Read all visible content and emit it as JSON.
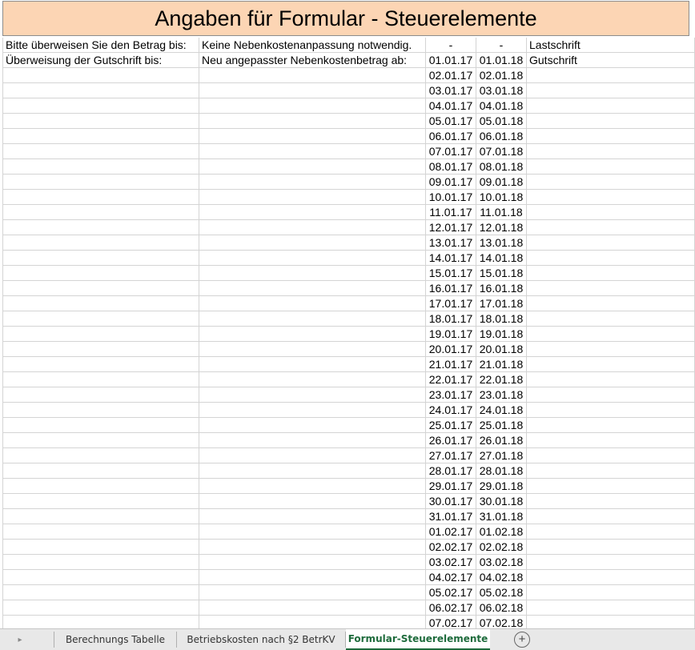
{
  "sheet": {
    "title": "Angaben für Formular - Steuerelemente",
    "rows": [
      [
        "Bitte überweisen Sie den Betrag bis:",
        "Keine Nebenkostenanpassung notwendig.",
        "-",
        "-",
        "Lastschrift"
      ],
      [
        "Überweisung der Gutschrift bis:",
        "Neu angepasster Nebenkostenbetrag ab:",
        "01.01.17",
        "01.01.18",
        "Gutschrift"
      ],
      [
        "",
        "",
        "02.01.17",
        "02.01.18",
        ""
      ],
      [
        "",
        "",
        "03.01.17",
        "03.01.18",
        ""
      ],
      [
        "",
        "",
        "04.01.17",
        "04.01.18",
        ""
      ],
      [
        "",
        "",
        "05.01.17",
        "05.01.18",
        ""
      ],
      [
        "",
        "",
        "06.01.17",
        "06.01.18",
        ""
      ],
      [
        "",
        "",
        "07.01.17",
        "07.01.18",
        ""
      ],
      [
        "",
        "",
        "08.01.17",
        "08.01.18",
        ""
      ],
      [
        "",
        "",
        "09.01.17",
        "09.01.18",
        ""
      ],
      [
        "",
        "",
        "10.01.17",
        "10.01.18",
        ""
      ],
      [
        "",
        "",
        "11.01.17",
        "11.01.18",
        ""
      ],
      [
        "",
        "",
        "12.01.17",
        "12.01.18",
        ""
      ],
      [
        "",
        "",
        "13.01.17",
        "13.01.18",
        ""
      ],
      [
        "",
        "",
        "14.01.17",
        "14.01.18",
        ""
      ],
      [
        "",
        "",
        "15.01.17",
        "15.01.18",
        ""
      ],
      [
        "",
        "",
        "16.01.17",
        "16.01.18",
        ""
      ],
      [
        "",
        "",
        "17.01.17",
        "17.01.18",
        ""
      ],
      [
        "",
        "",
        "18.01.17",
        "18.01.18",
        ""
      ],
      [
        "",
        "",
        "19.01.17",
        "19.01.18",
        ""
      ],
      [
        "",
        "",
        "20.01.17",
        "20.01.18",
        ""
      ],
      [
        "",
        "",
        "21.01.17",
        "21.01.18",
        ""
      ],
      [
        "",
        "",
        "22.01.17",
        "22.01.18",
        ""
      ],
      [
        "",
        "",
        "23.01.17",
        "23.01.18",
        ""
      ],
      [
        "",
        "",
        "24.01.17",
        "24.01.18",
        ""
      ],
      [
        "",
        "",
        "25.01.17",
        "25.01.18",
        ""
      ],
      [
        "",
        "",
        "26.01.17",
        "26.01.18",
        ""
      ],
      [
        "",
        "",
        "27.01.17",
        "27.01.18",
        ""
      ],
      [
        "",
        "",
        "28.01.17",
        "28.01.18",
        ""
      ],
      [
        "",
        "",
        "29.01.17",
        "29.01.18",
        ""
      ],
      [
        "",
        "",
        "30.01.17",
        "30.01.18",
        ""
      ],
      [
        "",
        "",
        "31.01.17",
        "31.01.18",
        ""
      ],
      [
        "",
        "",
        "01.02.17",
        "01.02.18",
        ""
      ],
      [
        "",
        "",
        "02.02.17",
        "02.02.18",
        ""
      ],
      [
        "",
        "",
        "03.02.17",
        "03.02.18",
        ""
      ],
      [
        "",
        "",
        "04.02.17",
        "04.02.18",
        ""
      ],
      [
        "",
        "",
        "05.02.17",
        "05.02.18",
        ""
      ],
      [
        "",
        "",
        "06.02.17",
        "06.02.18",
        ""
      ],
      [
        "",
        "",
        "07.02.17",
        "07.02.18",
        ""
      ]
    ]
  },
  "tabs": {
    "items": [
      {
        "label": "Berechnungs Tabelle",
        "active": false
      },
      {
        "label": "Betriebskosten nach §2 BetrKV",
        "active": false
      },
      {
        "label": "Formular-Steuerelemente",
        "active": true
      }
    ],
    "add_symbol": "+",
    "nav_symbol": "▸"
  },
  "colors": {
    "title_fill": "#fcd5b4",
    "active_tab_text": "#1e6b3c"
  }
}
